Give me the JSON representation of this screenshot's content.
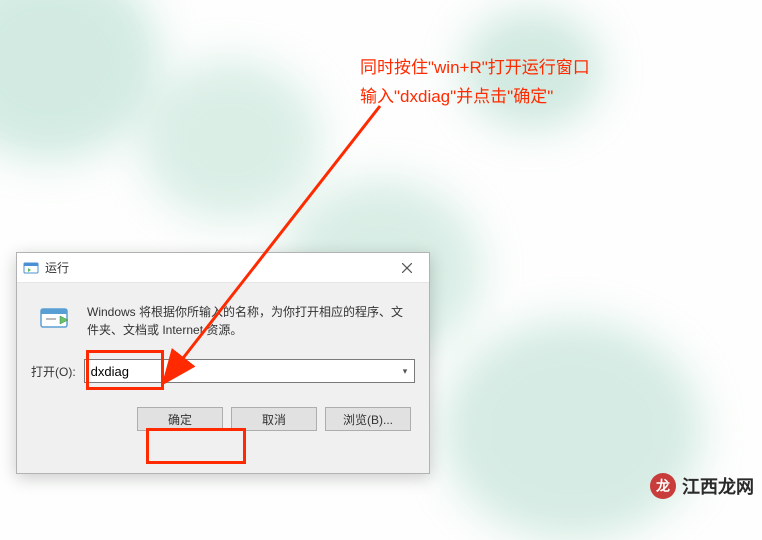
{
  "annotation": {
    "line1": "同时按住\"win+R\"打开运行窗口",
    "line2": "输入\"dxdiag\"并点击\"确定\""
  },
  "dialog": {
    "title": "运行",
    "description": "Windows 将根据你所输入的名称，为你打开相应的程序、文件夹、文档或 Internet 资源。",
    "input_label": "打开(O):",
    "input_value": "dxdiag",
    "buttons": {
      "ok": "确定",
      "cancel": "取消",
      "browse": "浏览(B)..."
    }
  },
  "watermark": {
    "logo_char": "龙",
    "text": "江西龙网"
  }
}
